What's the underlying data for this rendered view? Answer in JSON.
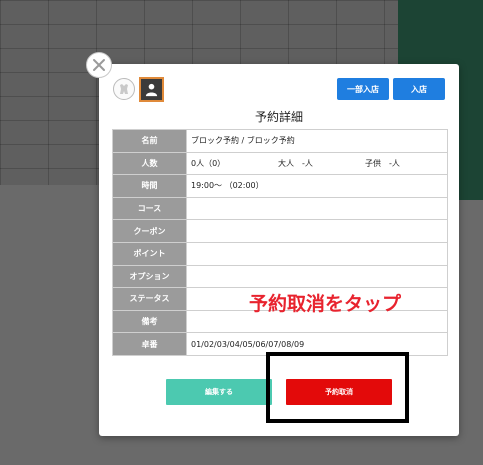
{
  "modal": {
    "title": "予約詳細",
    "buttons": {
      "partial_checkin": "一部入店",
      "checkin": "入店",
      "edit": "編集する",
      "cancel_reservation": "予約取消"
    },
    "rows": [
      {
        "label": "名前",
        "value": "ブロック予約 / ブロック予約"
      },
      {
        "label": "人数",
        "value": "0人（0）",
        "adult": "大人　-人",
        "child": "子供　-人"
      },
      {
        "label": "時間",
        "value": "19:00〜 （02:00）"
      },
      {
        "label": "コース",
        "value": ""
      },
      {
        "label": "クーポン",
        "value": ""
      },
      {
        "label": "ポイント",
        "value": ""
      },
      {
        "label": "オプション",
        "value": ""
      },
      {
        "label": "ステータス",
        "value": ""
      },
      {
        "label": "備考",
        "value": ""
      },
      {
        "label": "卓番",
        "value": "01/02/03/04/05/06/07/08/09"
      }
    ]
  },
  "annotation": {
    "text": "予約取消をタップ"
  },
  "colors": {
    "primary_blue": "#1f7ee0",
    "edit_teal": "#4cc9b0",
    "cancel_red": "#e30a0a",
    "label_gray": "#9b9b9b",
    "annotation_red": "#e8232e"
  },
  "icons": {
    "close": "close-icon",
    "avatar_1": "dog-icon",
    "avatar_2": "person-icon"
  }
}
